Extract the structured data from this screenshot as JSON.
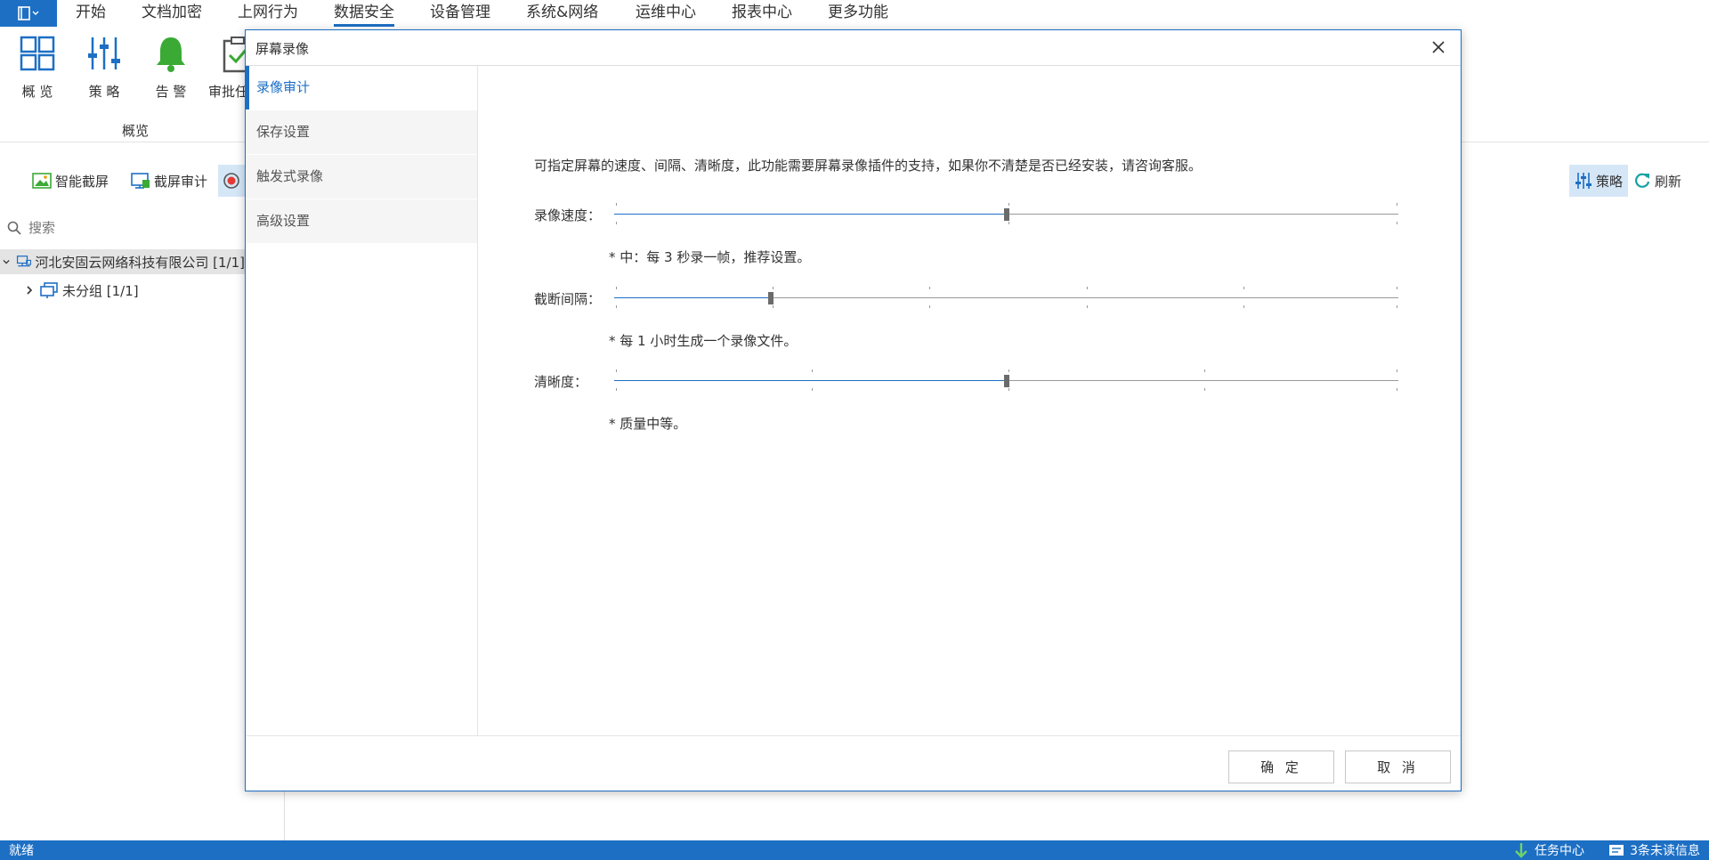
{
  "menu": {
    "tabs": [
      "开始",
      "文档加密",
      "上网行为",
      "数据安全",
      "设备管理",
      "系统&网络",
      "运维中心",
      "报表中心",
      "更多功能"
    ],
    "active_tab": "数据安全"
  },
  "ribbon": {
    "buttons": [
      {
        "label": "概 览",
        "icon": "grid-icon"
      },
      {
        "label": "策 略",
        "icon": "sliders-icon"
      },
      {
        "label": "告 警",
        "icon": "bell-icon"
      },
      {
        "label": "审批任",
        "icon": "clipboard-check-icon"
      }
    ],
    "group_label": "概览"
  },
  "toolbar": {
    "smart_screenshot": "智能截屏",
    "screenshot_audit": "截屏审计",
    "strategy": "策略",
    "refresh": "刷新"
  },
  "search": {
    "placeholder": "搜索"
  },
  "tree": {
    "company": "河北安固云网络科技有限公司  [1/1]",
    "ungrouped": "未分组  [1/1]"
  },
  "status_bar": {
    "status": "就绪",
    "task_center": "任务中心",
    "unread": "3条未读信息"
  },
  "dialog": {
    "title": "屏幕录像",
    "nav": [
      "录像审计",
      "保存设置",
      "触发式录像",
      "高级设置"
    ],
    "active_nav": 0,
    "description": "可指定屏幕的速度、间隔、清晰度，此功能需要屏幕录像插件的支持，如果你不清楚是否已经安装，请咨询客服。",
    "settings": [
      {
        "label": "录像速度：",
        "note": "* 中：每 3 秒录一帧，推荐设置。",
        "steps": 2,
        "value": 1
      },
      {
        "label": "截断间隔：",
        "note": "* 每 1 小时生成一个录像文件。",
        "steps": 5,
        "value": 1
      },
      {
        "label": "清晰度：",
        "note": "* 质量中等。",
        "steps": 4,
        "value": 2
      }
    ],
    "confirm": "确 定",
    "cancel": "取 消"
  },
  "colors": {
    "accent": "#1d6fc4",
    "bell": "#3aaa35"
  }
}
